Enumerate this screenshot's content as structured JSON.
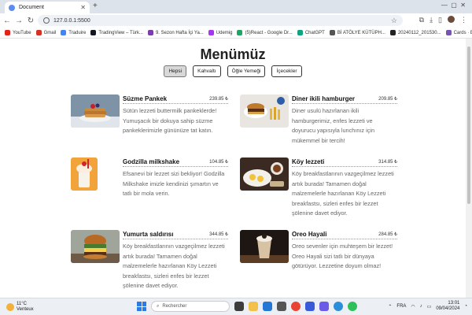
{
  "browser": {
    "tab_title": "Document",
    "url": "127.0.0.1:5500",
    "bookmarks": [
      {
        "label": "YouTube",
        "color": "#e62117"
      },
      {
        "label": "Gmail",
        "color": "#d93025"
      },
      {
        "label": "Traduire",
        "color": "#4285f4"
      },
      {
        "label": "TradingView – Türk...",
        "color": "#131722"
      },
      {
        "label": "9. Sezon Hafta İçi Ya...",
        "color": "#7a3ea8"
      },
      {
        "label": "Udemig",
        "color": "#a435f0"
      },
      {
        "label": "(5)React - Google Dr...",
        "color": "#1fa463"
      },
      {
        "label": "ChatGPT",
        "color": "#10a37f"
      },
      {
        "label": "Bİ ATÖLYE KÜTÜPH...",
        "color": "#555555"
      },
      {
        "label": "20240112_201530...",
        "color": "#222222"
      },
      {
        "label": "Cards · Bootstrap v5.1",
        "color": "#7952b3"
      }
    ]
  },
  "menu": {
    "title": "Menümüz",
    "filters": [
      "Hepsi",
      "Kahvaltı",
      "Öğle Yemeği",
      "İçecekler"
    ],
    "items": [
      {
        "name": "Süzme Pankek",
        "price": "239.85 ₺",
        "desc": "Sütün lezzeti buttermilk pankeklerde! Yumuşacık bir dokuya sahip süzme pankeklerimizle gününüze tat katın."
      },
      {
        "name": "Diner ikili hamburger",
        "price": "209.85 ₺",
        "desc": "Diner usulü hazırlanan ikili hamburgerimiz, enfes lezzeti ve doyurucu yapısıyla lunchınız için mükemmel bir tercih!"
      },
      {
        "name": "Godzilla milkshake",
        "price": "104.85 ₺",
        "desc": "Efsanevi bir lezzet sizi bekliyor! Godzilla Milkshake imizle kendinizi şımartın ve tatlı bir mola verin."
      },
      {
        "name": "Köy lezzeti",
        "price": "314.85 ₺",
        "desc": "Köy breakfastlarının vazgeçilmez lezzeti artık burada! Tamamen doğal malzemelerle hazırlanan Köy Lezzeti breakfastsı, sizleri enfes bir lezzet şölenine davet ediyor."
      },
      {
        "name": "Yumurta saldırısı",
        "price": "344.85 ₺",
        "desc": "Köy breakfastlarının vazgeçilmez lezzeti artık burada! Tamamen doğal malzemelerle hazırlanan Köy Lezzeti breakfastsı, sizleri enfes bir lezzet şölenine davet ediyor."
      },
      {
        "name": "Oreo Hayali",
        "price": "284.85 ₺",
        "desc": "Oreo sevenler için muhteşem bir lezzet! Oreo Hayali sizi tatlı bir dünyaya götürüyor. Lezzetine doyum olmaz!"
      }
    ]
  },
  "taskbar": {
    "temp": "11°C",
    "weather": "Venteux",
    "search_placeholder": "Rechercher",
    "lang": "FRA",
    "time": "13:01",
    "date": "09/04/2024"
  }
}
